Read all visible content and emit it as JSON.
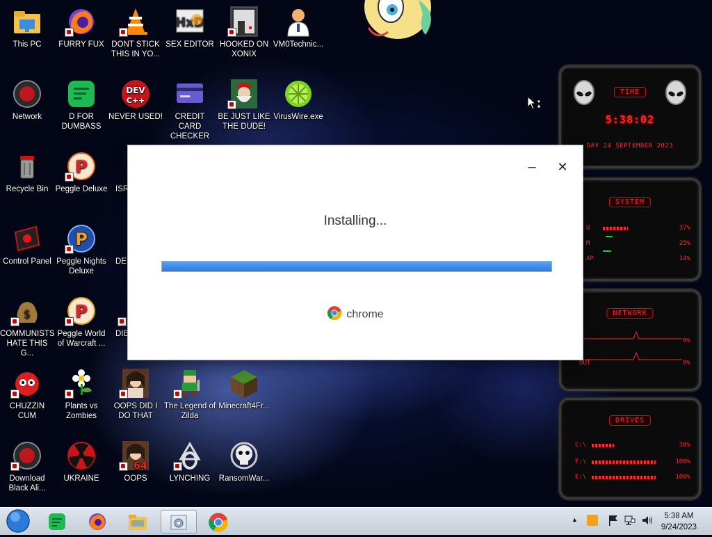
{
  "desktop": {
    "icons": [
      {
        "label": "This PC"
      },
      {
        "label": "FURRY FUX"
      },
      {
        "label": "DONT STICK THIS IN YO..."
      },
      {
        "label": "SEX EDITOR"
      },
      {
        "label": "HOOKED ON XONIX"
      },
      {
        "label": "VM0Technic..."
      },
      {
        "label": "Network"
      },
      {
        "label": "D FOR DUMBASS"
      },
      {
        "label": "NEVER USED!"
      },
      {
        "label": "CREDIT CARD CHECKER"
      },
      {
        "label": "BE JUST LIKE THE DUDE!"
      },
      {
        "label": "VirusWire.exe"
      },
      {
        "label": "Recycle Bin"
      },
      {
        "label": "Peggle Deluxe"
      },
      {
        "label": "ISRA"
      },
      {
        "label": "Control Panel"
      },
      {
        "label": "Peggle Nights Deluxe"
      },
      {
        "label": "DEE"
      },
      {
        "label": "COMMUNISTS HATE THIS G..."
      },
      {
        "label": "Peggle World of Warcraft ..."
      },
      {
        "label": "DIE"
      },
      {
        "label": "CHUZZIN CUM"
      },
      {
        "label": "Plants vs Zombies"
      },
      {
        "label": "OOPS DID I DO THAT"
      },
      {
        "label": "The Legend of Zilda"
      },
      {
        "label": "Minecraft4Fr..."
      },
      {
        "label": "Download Black Ali..."
      },
      {
        "label": "UKRAINE"
      },
      {
        "label": "OOPS"
      },
      {
        "label": "LYNCHING"
      },
      {
        "label": "RansomWar..."
      }
    ],
    "dev_icon_text": "DEV",
    "dev_icon_sub": "C++"
  },
  "installer": {
    "status": "Installing...",
    "progress": 1.0,
    "brand": "chrome",
    "minimize_glyph": "–",
    "close_glyph": "✕"
  },
  "gadget": {
    "time_header": "TIME",
    "time": "5:38:02",
    "date": "DAY 24 SEPTEMBER 2023",
    "system_header": "SYSTEM",
    "system_rows": [
      {
        "label": "U",
        "value": "37%"
      },
      {
        "label": "M",
        "value": "25%"
      },
      {
        "label": "AP",
        "value": "14%"
      }
    ],
    "network_header": "NETWORK",
    "network_rows": [
      {
        "label": "",
        "value": "0%"
      },
      {
        "label": "OUT",
        "value": "0%"
      }
    ],
    "drives_header": "DRIVES",
    "drive_rows": [
      {
        "label": "C:\\",
        "value": "38%"
      },
      {
        "label": "F:\\",
        "value": "100%"
      },
      {
        "label": "E:\\",
        "value": "100%"
      }
    ]
  },
  "taskbar": {
    "clock_time": "5:38 AM",
    "clock_date": "9/24/2023"
  },
  "colors": {
    "accent_blue": "#2f79dc",
    "gadget_red": "#ff2a2a"
  }
}
